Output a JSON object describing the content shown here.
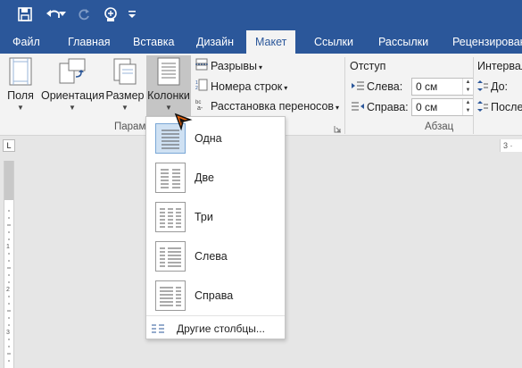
{
  "qat": {
    "save_icon": "save-icon",
    "undo_icon": "undo-icon",
    "redo_icon": "redo-icon",
    "touch_icon": "touch-mode-icon",
    "customize_icon": "customize-qat-icon"
  },
  "tabs": [
    {
      "label": "Файл"
    },
    {
      "label": "Главная"
    },
    {
      "label": "Вставка"
    },
    {
      "label": "Дизайн"
    },
    {
      "label": "Макет"
    },
    {
      "label": "Ссылки"
    },
    {
      "label": "Рассылки"
    },
    {
      "label": "Рецензирован"
    }
  ],
  "ribbon": {
    "margins_label": "Поля",
    "orientation_label": "Ориентация",
    "size_label": "Размер",
    "columns_label": "Колонки",
    "breaks_label": "Разрывы",
    "line_numbers_label": "Номера строк",
    "hyphenation_label": "Расстановка переносов",
    "page_setup_group": "Парам",
    "indent_title": "Отступ",
    "left_label": "Слева:",
    "left_value": "0 см",
    "right_label": "Справа:",
    "right_value": "0 см",
    "spacing_title": "Интервал",
    "before_label": "До:",
    "after_label": "После",
    "paragraph_group": "Абзац"
  },
  "columns_menu": {
    "items": [
      {
        "label": "Одна",
        "cols": 1
      },
      {
        "label": "Две",
        "cols": 2
      },
      {
        "label": "Три",
        "cols": 3
      },
      {
        "label": "Слева",
        "cols": "left"
      },
      {
        "label": "Справа",
        "cols": "right"
      }
    ],
    "selected_index": 0,
    "more_label": "Другие столбцы..."
  },
  "colors": {
    "accent": "#2b579a",
    "cursor": "#e8600a"
  }
}
